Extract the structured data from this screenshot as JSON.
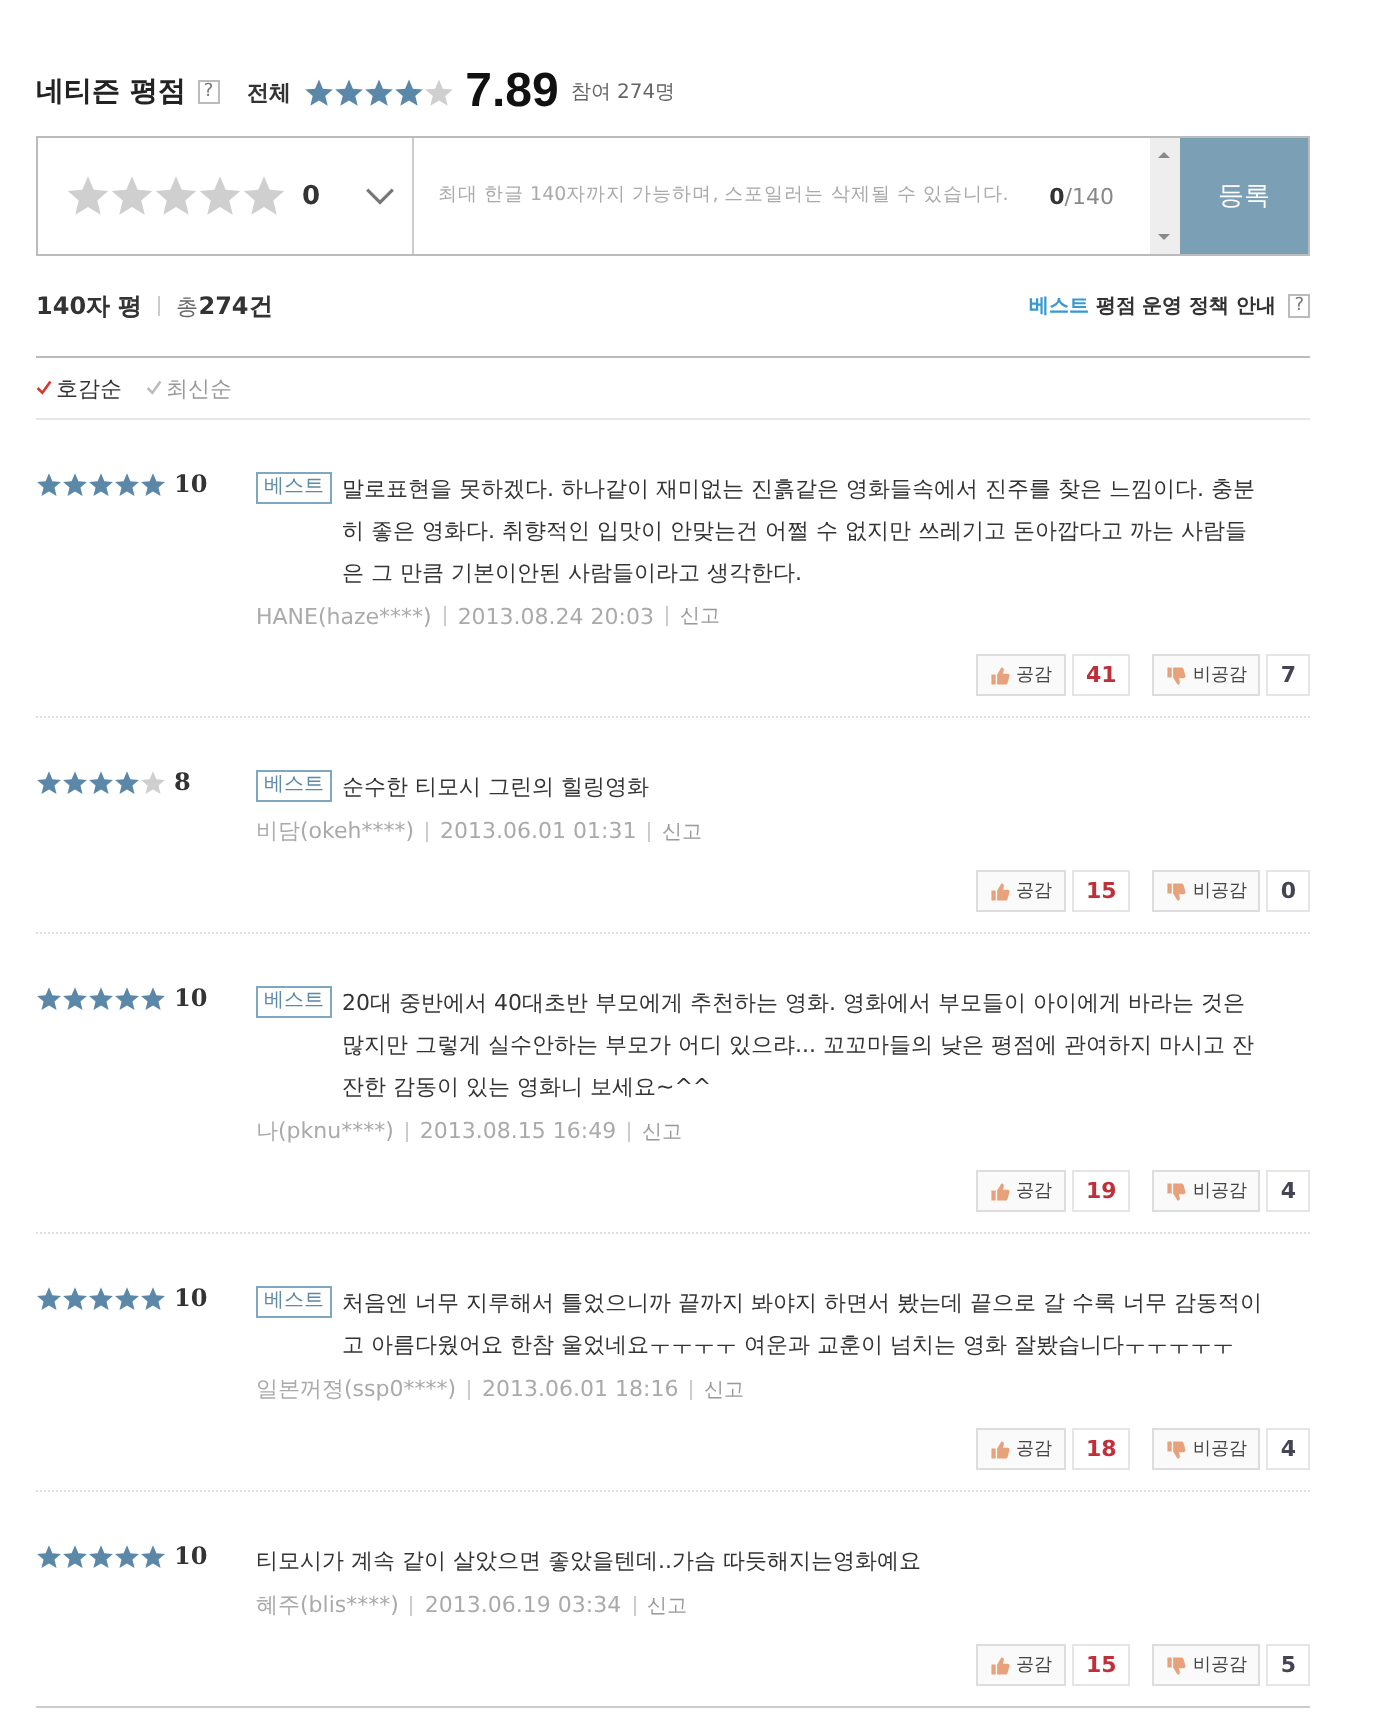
{
  "header": {
    "title": "네티즌 평점",
    "help": "?",
    "scope": "전체",
    "stars": 4,
    "score": "7.89",
    "participants": "참여 274명"
  },
  "rating_input": {
    "stars": 0,
    "value": "0",
    "placeholder": "최대 한글 140자까지 가능하며, 스포일러는 삭제될 수 있습니다.",
    "count": "0",
    "limit": "/140",
    "submit": "등록"
  },
  "summary": {
    "label": "140자 평",
    "total_prefix": "총",
    "total": "274건",
    "policy_best": "베스트",
    "policy": "평점 운영 정책 안내",
    "policy_help": "?"
  },
  "sort": [
    {
      "label": "호감순",
      "selected": true
    },
    {
      "label": "최신순",
      "selected": false
    }
  ],
  "reviews": [
    {
      "stars": 5,
      "score": "10",
      "badge": "베스트",
      "text": "말로표현을 못하겠다. 하나같이 재미없는 진흙같은 영화들속에서 진주를 찾은 느낌이다. 충분히 좋은 영화다. 취향적인 입맛이 안맞는건 어쩔 수 없지만 쓰레기고 돈아깝다고 까는 사람들은 그 만큼 기본이안된 사람들이라고 생각한다.",
      "author": "HANE(haze****)",
      "date": "2013.08.24 20:03",
      "report": "신고",
      "like_label": "공감",
      "likes": "41",
      "dislike_label": "비공감",
      "dislikes": "7"
    },
    {
      "stars": 4,
      "score": "8",
      "badge": "베스트",
      "text": "순수한 티모시 그린의 힐링영화",
      "author": "비담(okeh****)",
      "date": "2013.06.01 01:31",
      "report": "신고",
      "like_label": "공감",
      "likes": "15",
      "dislike_label": "비공감",
      "dislikes": "0"
    },
    {
      "stars": 5,
      "score": "10",
      "badge": "베스트",
      "text": "20대 중반에서 40대초반 부모에게 추천하는 영화. 영화에서 부모들이 아이에게 바라는 것은 많지만 그렇게 실수안하는 부모가 어디 있으랴... 꼬꼬마들의 낮은 평점에 관여하지 마시고 잔잔한 감동이 있는 영화니 보세요~^^",
      "author": "나(pknu****)",
      "date": "2013.08.15 16:49",
      "report": "신고",
      "like_label": "공감",
      "likes": "19",
      "dislike_label": "비공감",
      "dislikes": "4"
    },
    {
      "stars": 5,
      "score": "10",
      "badge": "베스트",
      "text": "처음엔 너무 지루해서 틀었으니까 끝까지 봐야지 하면서 봤는데 끝으로 갈 수록 너무 감동적이고 아름다웠어요 한참 울었네요ㅜㅜㅜㅜ 여운과 교훈이 넘치는 영화 잘봤습니다ㅜㅜㅜㅜㅜ",
      "author": "일본꺼졍(ssp0****)",
      "date": "2013.06.01 18:16",
      "report": "신고",
      "like_label": "공감",
      "likes": "18",
      "dislike_label": "비공감",
      "dislikes": "4"
    },
    {
      "stars": 5,
      "score": "10",
      "text": "티모시가 계속 같이 살았으면 좋았을텐데..가슴 따듯해지는영화예요",
      "author": "혜주(blis****)",
      "date": "2013.06.19 03:34",
      "report": "신고",
      "like_label": "공감",
      "likes": "15",
      "dislike_label": "비공감",
      "dislikes": "5"
    }
  ]
}
